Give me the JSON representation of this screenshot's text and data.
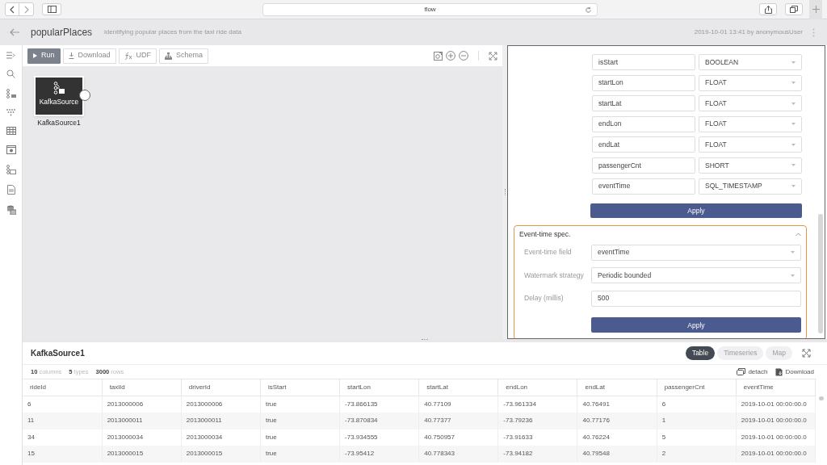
{
  "browser": {
    "url": "flow"
  },
  "header": {
    "title": "popularPlaces",
    "subtitle": "identifying popular places from the taxi ride data",
    "meta": "2019-10-01 13:41 by anonymousUser"
  },
  "toolbar": {
    "buttons": [
      {
        "label": "Run",
        "kind": "primary"
      },
      {
        "label": "Download",
        "kind": "plain"
      },
      {
        "label": "UDF",
        "kind": "plain"
      },
      {
        "label": "Schema",
        "kind": "plain"
      }
    ]
  },
  "node": {
    "title": "KafkaSource",
    "label": "KafkaSource1"
  },
  "schema": {
    "fields": [
      {
        "name": "isStart",
        "type": "BOOLEAN"
      },
      {
        "name": "startLon",
        "type": "FLOAT"
      },
      {
        "name": "startLat",
        "type": "FLOAT"
      },
      {
        "name": "endLon",
        "type": "FLOAT"
      },
      {
        "name": "endLat",
        "type": "FLOAT"
      },
      {
        "name": "passengerCnt",
        "type": "SHORT"
      },
      {
        "name": "eventTime",
        "type": "SQL_TIMESTAMP"
      }
    ],
    "apply": "Apply"
  },
  "event_time": {
    "title": "Event-time spec.",
    "expanded": true,
    "rows": [
      {
        "label": "Event-time field",
        "value": "eventTime",
        "kind": "select"
      },
      {
        "label": "Watermark strategy",
        "value": "Periodic bounded",
        "kind": "select"
      },
      {
        "label": "Delay (millis)",
        "value": "500",
        "kind": "input"
      }
    ],
    "apply": "Apply"
  },
  "results": {
    "title": "KafkaSource1",
    "stats": [
      {
        "count": "10",
        "unit": "columns"
      },
      {
        "count": "5",
        "unit": "types"
      },
      {
        "count": "3000",
        "unit": "rows"
      }
    ],
    "views": [
      {
        "label": "Table",
        "selected": true
      },
      {
        "label": "Timeseries",
        "selected": false
      },
      {
        "label": "Map",
        "selected": false
      }
    ],
    "actions": [
      "detach",
      "Download"
    ],
    "table": {
      "columns": [
        "rideId",
        "taxiId",
        "driverId",
        "isStart",
        "startLon",
        "startLat",
        "endLon",
        "endLat",
        "passengerCnt",
        "eventTime"
      ],
      "rows": [
        [
          "6",
          "2013000006",
          "2013000006",
          "true",
          "-73.866135",
          "40.77109",
          "-73.961334",
          "40.76491",
          "6",
          "2019-10-01 00:00:00.0"
        ],
        [
          "11",
          "2013000011",
          "2013000011",
          "true",
          "-73.870834",
          "40.77377",
          "-73.79236",
          "40.77176",
          "1",
          "2019-10-01 00:00:00.0"
        ],
        [
          "34",
          "2013000034",
          "2013000034",
          "true",
          "-73.934555",
          "40.750957",
          "-73.91633",
          "40.76224",
          "5",
          "2019-10-01 00:00:00.0"
        ],
        [
          "15",
          "2013000015",
          "2013000015",
          "true",
          "-73.95412",
          "40.778343",
          "-73.94182",
          "40.79548",
          "2",
          "2019-10-01 00:00:00.0"
        ]
      ]
    }
  }
}
